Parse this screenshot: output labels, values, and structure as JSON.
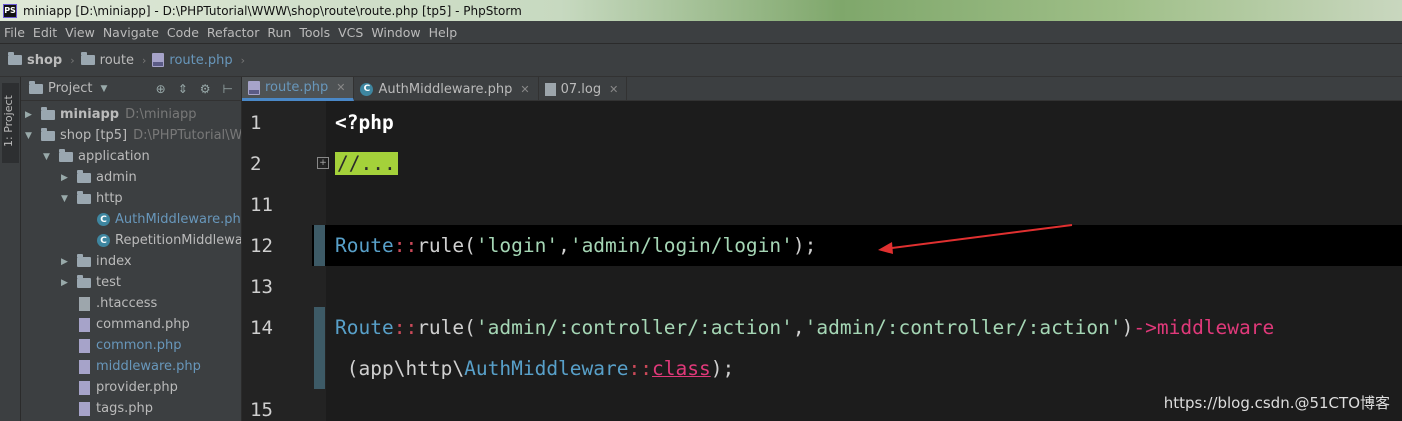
{
  "window": {
    "title": "miniapp [D:\\miniapp] - D:\\PHPTutorial\\WWW\\shop\\route\\route.php [tp5] - PhpStorm",
    "logo": "PS"
  },
  "menu": [
    "File",
    "Edit",
    "View",
    "Navigate",
    "Code",
    "Refactor",
    "Run",
    "Tools",
    "VCS",
    "Window",
    "Help"
  ],
  "breadcrumb": [
    "shop",
    "route",
    "route.php"
  ],
  "side_tab": "1: Project",
  "project": {
    "title": "Project",
    "tree": [
      {
        "label": "miniapp",
        "hint": "D:\\miniapp",
        "kind": "folder",
        "arrow": "▶"
      },
      {
        "label": "shop [tp5]",
        "hint": "D:\\PHPTutorial\\WWW",
        "kind": "folder",
        "arrow": "▼"
      },
      {
        "label": "application",
        "kind": "folder",
        "arrow": "▼"
      },
      {
        "label": "admin",
        "kind": "folder",
        "arrow": "▶"
      },
      {
        "label": "http",
        "kind": "folder",
        "arrow": "▼"
      },
      {
        "label": "AuthMiddleware.php",
        "kind": "class"
      },
      {
        "label": "RepetitionMiddleware",
        "kind": "class"
      },
      {
        "label": "index",
        "kind": "folder",
        "arrow": "▶"
      },
      {
        "label": "test",
        "kind": "folder",
        "arrow": "▶"
      },
      {
        "label": ".htaccess",
        "kind": "file"
      },
      {
        "label": "command.php",
        "kind": "php"
      },
      {
        "label": "common.php",
        "kind": "php"
      },
      {
        "label": "middleware.php",
        "kind": "php"
      },
      {
        "label": "provider.php",
        "kind": "php"
      },
      {
        "label": "tags.php",
        "kind": "php"
      }
    ]
  },
  "tabs": [
    {
      "label": "route.php",
      "active": true
    },
    {
      "label": "AuthMiddleware.php",
      "active": false
    },
    {
      "label": "07.log",
      "active": false
    }
  ],
  "editor": {
    "line_numbers": [
      "1",
      "2",
      "11",
      "12",
      "13",
      "14",
      "15"
    ],
    "php_open": "<?php",
    "folded": "//...",
    "line12": {
      "cls": "Route",
      "op": "::",
      "fn": "rule(",
      "s1": "'login'",
      "comma": ",",
      "s2": "'admin/login/login'",
      "end": ");"
    },
    "line14a": {
      "cls": "Route",
      "op": "::",
      "fn": "rule(",
      "s1": "'admin/:controller/:action'",
      "comma": ",",
      "s2": "'admin/:controller/:action'",
      "close": ")",
      "arrow": "->",
      "method": "middleware"
    },
    "line14b": {
      "open": " (app\\http\\",
      "cls": "AuthMiddleware",
      "op": "::",
      "kw": "class",
      "end": ");"
    }
  },
  "watermark": "https://blog.csdn.@51CTO博客",
  "colors": {
    "accent": "#4a88c7",
    "fold": "#a4d13a",
    "arrow": "#e03030"
  }
}
